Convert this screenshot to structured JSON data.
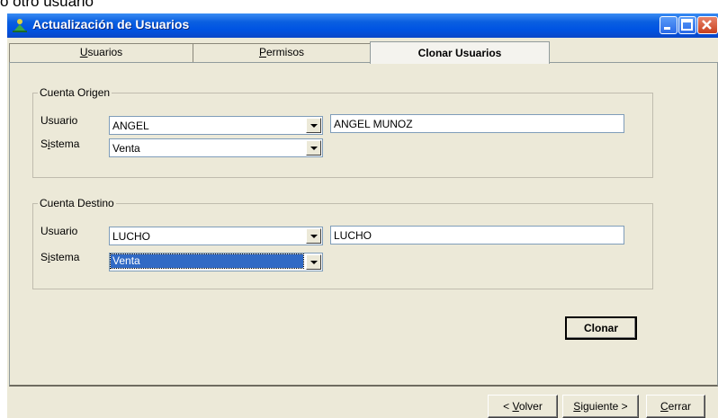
{
  "top_cropped_text": "o otro usuario",
  "window": {
    "title": "Actualización de Usuarios",
    "minimize_icon": "minimize-icon",
    "maximize_icon": "maximize-icon",
    "close_icon": "close-icon",
    "app_icon": "app-icon"
  },
  "tabs": [
    {
      "label": "Usuarios",
      "accel": "U",
      "rest": "suarios"
    },
    {
      "label": "Permisos",
      "accel": "P",
      "rest": "ermisos"
    },
    {
      "label": "Clonar Usuarios"
    }
  ],
  "origen": {
    "legend": "Cuenta Origen",
    "usuario_label": "Usuario",
    "sistema_label_pre": "S",
    "sistema_label_accel": "i",
    "sistema_label_post": "stema",
    "usuario_value": "ANGEL",
    "usuario_name": "ANGEL MUNOZ",
    "sistema_value": "Venta"
  },
  "destino": {
    "legend": "Cuenta Destino",
    "usuario_label": "Usuario",
    "sistema_label_pre": "S",
    "sistema_label_accel": "i",
    "sistema_label_post": "stema",
    "usuario_value": "LUCHO",
    "usuario_name": "LUCHO",
    "sistema_value": "Venta"
  },
  "clonar_button": "Clonar",
  "footer": {
    "volver_pre": "< ",
    "volver_accel": "V",
    "volver_rest": "olver",
    "siguiente_accel": "S",
    "siguiente_rest": "iguiente >",
    "cerrar_accel": "C",
    "cerrar_rest": "errar"
  }
}
